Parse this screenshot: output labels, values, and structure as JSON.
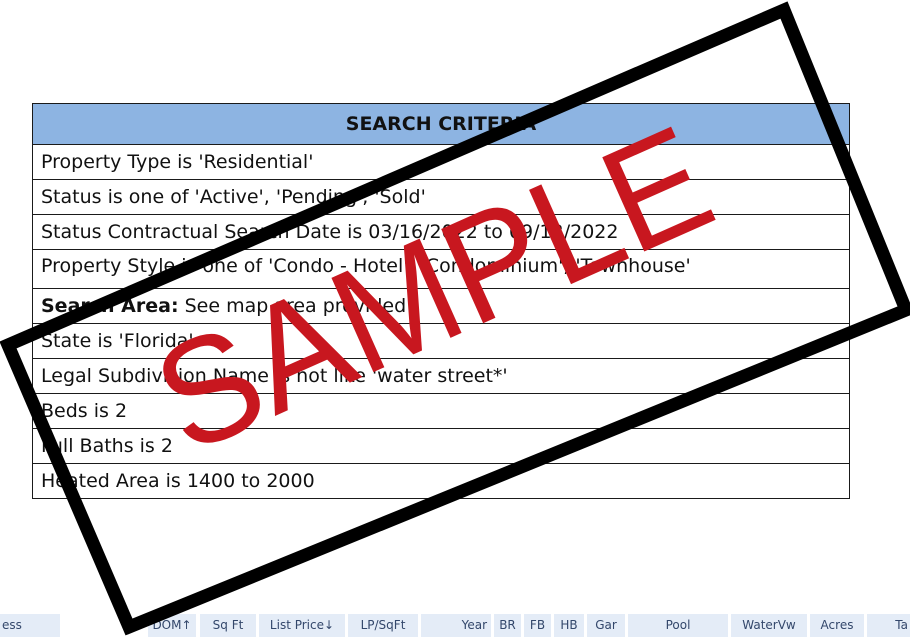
{
  "criteria": {
    "title": "SEARCH CRITERIA",
    "rows": [
      "Property Type is 'Residential'",
      "Status is one of 'Active', 'Pending', 'Sold'",
      "Status Contractual Search Date is 03/16/2022 to 09/12/2022",
      "Property Style is one of 'Condo - Hotel', 'Condominium', 'Townhouse'",
      {
        "bold": "Search Area:",
        "text": " See map area provided"
      },
      "State is 'Florida'",
      "Legal Subdivision Name is not like 'water street*'",
      "Beds is 2",
      "Full Baths is 2",
      "Heated Area is 1400 to 2000"
    ]
  },
  "columns": {
    "address": "ess",
    "dom": "DOM",
    "sqft": "Sq Ft",
    "list_price": "List Price",
    "lp_sqft": "LP/SqFt",
    "year": "Year",
    "br": "BR",
    "fb": "FB",
    "hb": "HB",
    "gar": "Gar",
    "pool": "Pool",
    "watervw": "WaterVw",
    "acres": "Acres",
    "ta": "Ta"
  },
  "sort_icons": {
    "dom": "arrow-up-icon",
    "list_price": "arrow-down-icon"
  },
  "watermark": "SAMPLE",
  "colors": {
    "header_bg": "#8db4e2",
    "watermark": "#c8171f",
    "column_bg": "#e4ecf7"
  }
}
